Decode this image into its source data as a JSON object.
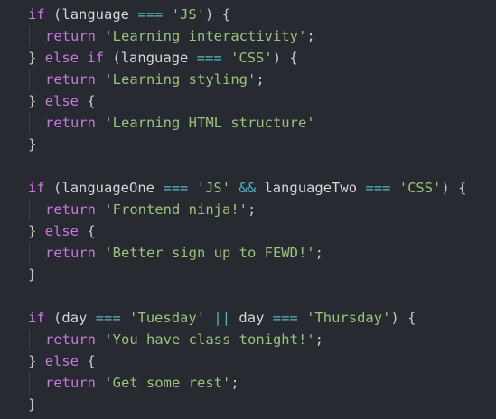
{
  "editor": {
    "blocks": [
      {
        "if_kw": "if",
        "cond_open": "(",
        "cond_a_var": "language",
        "cond_a_op": "===",
        "cond_a_val": "'JS'",
        "cond_close": ")",
        "brace_open": "{",
        "return_kw": "return",
        "return_val": "'Learning interactivity'",
        "semi": ";",
        "elseif_close": "}",
        "else_kw": "else",
        "elseif_if_kw": "if",
        "elseif_open": "(",
        "elseif_var": "language",
        "elseif_op": "===",
        "elseif_val": "'CSS'",
        "elseif_close_paren": ")",
        "elseif_brace": "{",
        "return2_kw": "return",
        "return2_val": "'Learning styling'",
        "else_close": "}",
        "else2_kw": "else",
        "else2_brace": "{",
        "return3_kw": "return",
        "return3_val": "'Learning HTML structure'",
        "end_brace": "}"
      },
      {
        "if_kw": "if",
        "cond_open": "(",
        "cond_a_var": "languageOne",
        "cond_a_op": "===",
        "cond_a_val": "'JS'",
        "logic_op": "&&",
        "cond_b_var": "languageTwo",
        "cond_b_op": "===",
        "cond_b_val": "'CSS'",
        "cond_close": ")",
        "brace_open": "{",
        "return_kw": "return",
        "return_val": "'Frontend ninja!'",
        "semi": ";",
        "else_close": "}",
        "else_kw": "else",
        "else_brace": "{",
        "return2_kw": "return",
        "return2_val": "'Better sign up to FEWD!'",
        "end_brace": "}"
      },
      {
        "if_kw": "if",
        "cond_open": "(",
        "cond_a_var": "day",
        "cond_a_op": "===",
        "cond_a_val": "'Tuesday'",
        "logic_op": "||",
        "cond_b_var": "day",
        "cond_b_op": "===",
        "cond_b_val": "'Thursday'",
        "cond_close": ")",
        "brace_open": "{",
        "return_kw": "return",
        "return_val": "'You have class tonight!'",
        "semi": ";",
        "else_close": "}",
        "else_kw": "else",
        "else_brace": "{",
        "return2_kw": "return",
        "return2_val": "'Get some rest'",
        "end_brace": "}"
      }
    ]
  }
}
